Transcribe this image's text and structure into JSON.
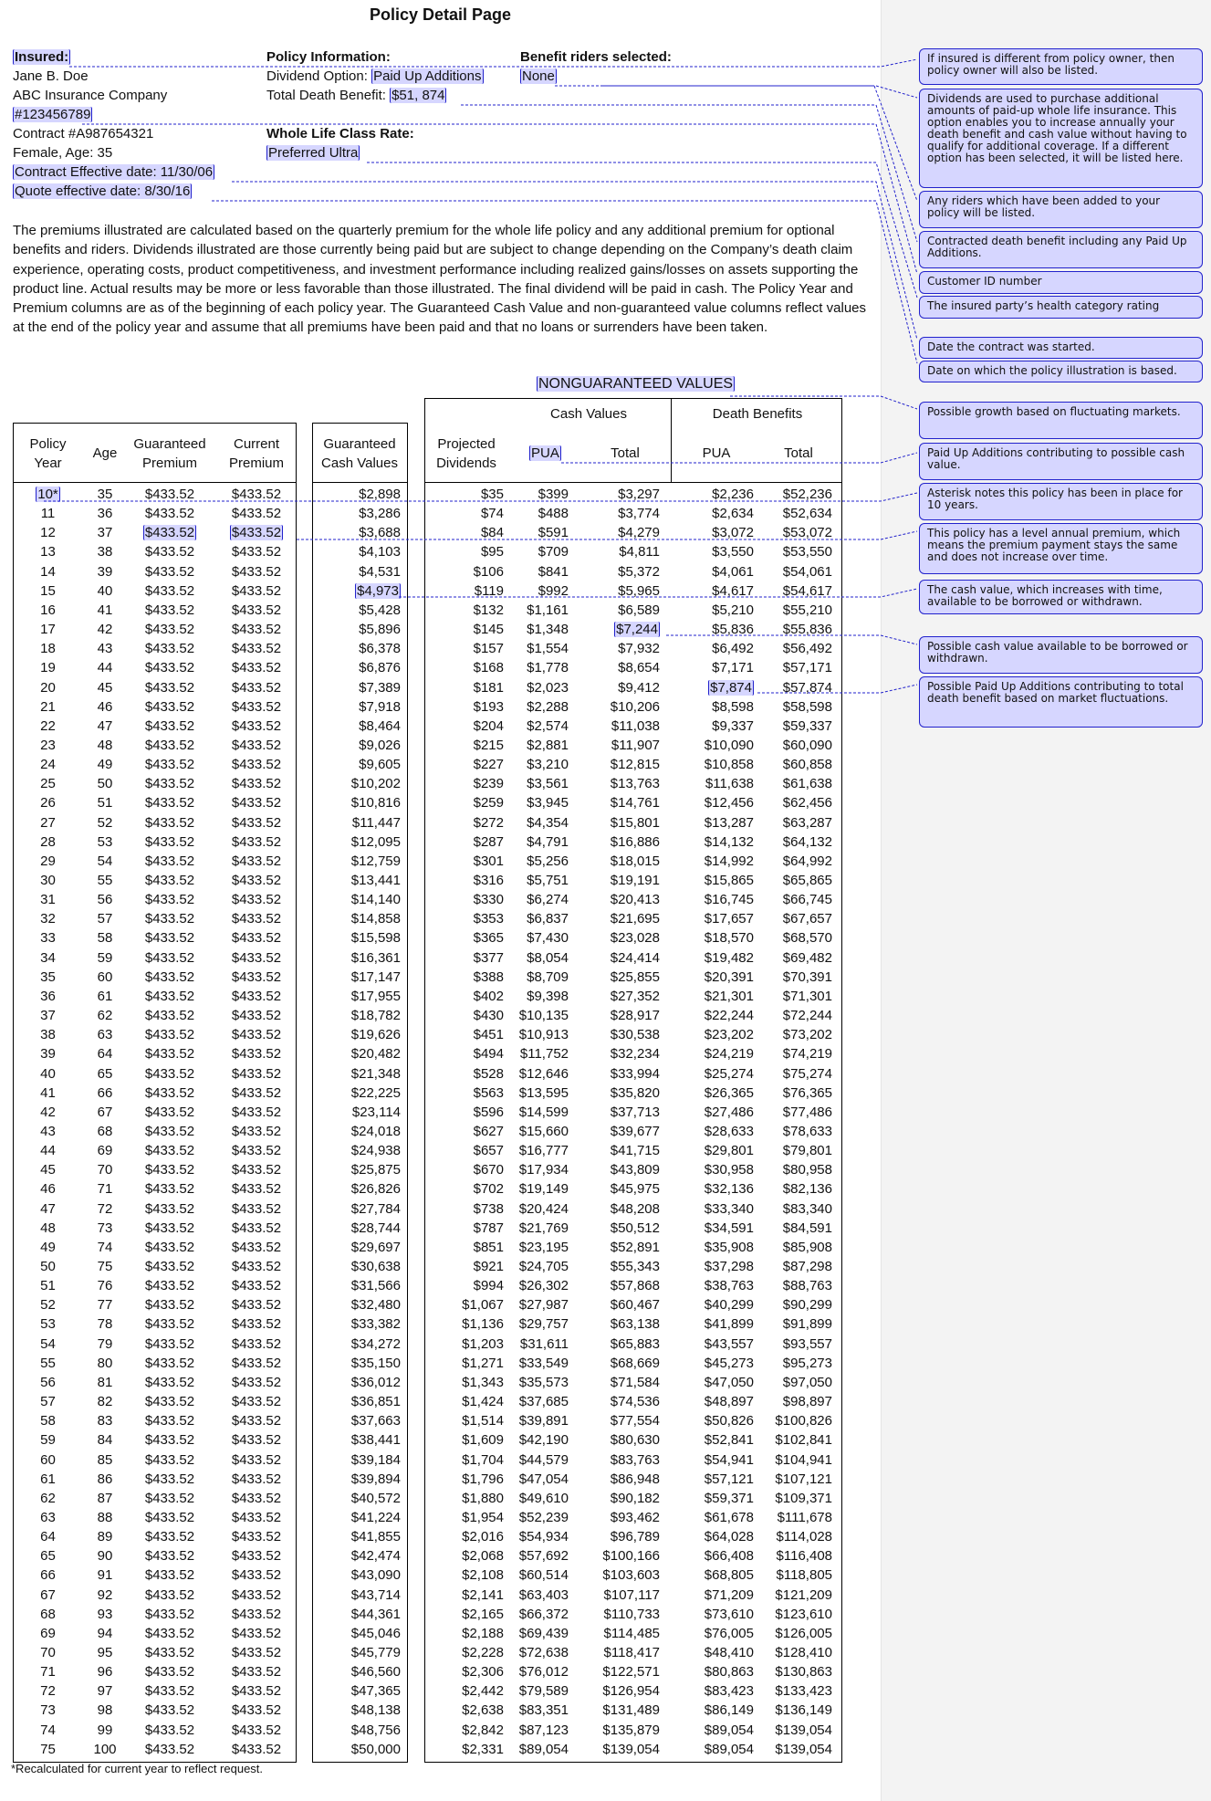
{
  "page_title": "Policy Detail Page",
  "insured": {
    "label": "Insured:",
    "name": "Jane B. Doe",
    "company": "ABC Insurance Company",
    "customer_id": "#123456789",
    "contract": "Contract #A987654321",
    "sex_age": "Female, Age: 35",
    "contract_effective": "Contract Effective date: 11/30/06",
    "quote_effective": "Quote effective date: 8/30/16"
  },
  "policy_info": {
    "label": "Policy Information:",
    "dividend_option_label": "Dividend Option: ",
    "dividend_option_value": "Paid Up Additions",
    "death_benefit_label": "Total Death Benefit: ",
    "death_benefit_value": "$51, 874",
    "class_rate_label": "Whole Life Class Rate:",
    "class_rate_value": "Preferred Ultra"
  },
  "riders": {
    "label": "Benefit riders selected:",
    "value": "None"
  },
  "disclaimer": "The premiums illustrated are calculated based on the quarterly premium for the whole life policy and any additional premium for optional benefits and riders. Dividends illustrated are those currently being paid but are subject to change depending on the Company’s death claim experience,  operating costs, product competitiveness, and investment performance including realized gains/losses on assets supporting the product line. Actual results may be more or less favorable than those illustrated. The final dividend will be paid in cash. The Policy Year and Premium columns are as of the beginning of each policy year. The Guaranteed Cash Value and non-guaranteed  value columns reflect values at the end of the policy year and assume that all premiums have been paid and that no loans or surrenders have been taken.",
  "table": {
    "nonguaranteed_title": "NONGUARANTEED VALUES",
    "group_cash_values": "Cash Values",
    "group_death_benefits": "Death  Benefits",
    "headers": {
      "policy_year": [
        "Policy",
        "Year"
      ],
      "age": "Age",
      "guaranteed_premium": [
        "Guaranteed",
        "Premium"
      ],
      "current_premium": [
        "Current",
        "Premium"
      ],
      "guaranteed_cash_values": [
        "Guaranteed",
        "Cash Values"
      ],
      "projected_dividends": [
        "Projected",
        "Dividends"
      ],
      "cv_pua": "PUA",
      "cv_total": "Total",
      "db_pua": "PUA",
      "db_total": "Total"
    },
    "rows": [
      [
        "10*",
        "35",
        "$433.52",
        "$433.52",
        "$2,898",
        "$35",
        "$399",
        "$3,297",
        "$2,236",
        "$52,236"
      ],
      [
        "11",
        "36",
        "$433.52",
        "$433.52",
        "$3,286",
        "$74",
        "$488",
        "$3,774",
        "$2,634",
        "$52,634"
      ],
      [
        "12",
        "37",
        "$433.52",
        "$433.52",
        "$3,688",
        "$84",
        "$591",
        "$4,279",
        "$3,072",
        "$53,072"
      ],
      [
        "13",
        "38",
        "$433.52",
        "$433.52",
        "$4,103",
        "$95",
        "$709",
        "$4,811",
        "$3,550",
        "$53,550"
      ],
      [
        "14",
        "39",
        "$433.52",
        "$433.52",
        "$4,531",
        "$106",
        "$841",
        "$5,372",
        "$4,061",
        "$54,061"
      ],
      [
        "15",
        "40",
        "$433.52",
        "$433.52",
        "$4,973",
        "$119",
        "$992",
        "$5,965",
        "$4,617",
        "$54,617"
      ],
      [
        "16",
        "41",
        "$433.52",
        "$433.52",
        "$5,428",
        "$132",
        "$1,161",
        "$6,589",
        "$5,210",
        "$55,210"
      ],
      [
        "17",
        "42",
        "$433.52",
        "$433.52",
        "$5,896",
        "$145",
        "$1,348",
        "$7,244",
        "$5,836",
        "$55,836"
      ],
      [
        "18",
        "43",
        "$433.52",
        "$433.52",
        "$6,378",
        "$157",
        "$1,554",
        "$7,932",
        "$6,492",
        "$56,492"
      ],
      [
        "19",
        "44",
        "$433.52",
        "$433.52",
        "$6,876",
        "$168",
        "$1,778",
        "$8,654",
        "$7,171",
        "$57,171"
      ],
      [
        "20",
        "45",
        "$433.52",
        "$433.52",
        "$7,389",
        "$181",
        "$2,023",
        "$9,412",
        "$7,874",
        "$57,874"
      ],
      [
        "21",
        "46",
        "$433.52",
        "$433.52",
        "$7,918",
        "$193",
        "$2,288",
        "$10,206",
        "$8,598",
        "$58,598"
      ],
      [
        "22",
        "47",
        "$433.52",
        "$433.52",
        "$8,464",
        "$204",
        "$2,574",
        "$11,038",
        "$9,337",
        "$59,337"
      ],
      [
        "23",
        "48",
        "$433.52",
        "$433.52",
        "$9,026",
        "$215",
        "$2,881",
        "$11,907",
        "$10,090",
        "$60,090"
      ],
      [
        "24",
        "49",
        "$433.52",
        "$433.52",
        "$9,605",
        "$227",
        "$3,210",
        "$12,815",
        "$10,858",
        "$60,858"
      ],
      [
        "25",
        "50",
        "$433.52",
        "$433.52",
        "$10,202",
        "$239",
        "$3,561",
        "$13,763",
        "$11,638",
        "$61,638"
      ],
      [
        "26",
        "51",
        "$433.52",
        "$433.52",
        "$10,816",
        "$259",
        "$3,945",
        "$14,761",
        "$12,456",
        "$62,456"
      ],
      [
        "27",
        "52",
        "$433.52",
        "$433.52",
        "$11,447",
        "$272",
        "$4,354",
        "$15,801",
        "$13,287",
        "$63,287"
      ],
      [
        "28",
        "53",
        "$433.52",
        "$433.52",
        "$12,095",
        "$287",
        "$4,791",
        "$16,886",
        "$14,132",
        "$64,132"
      ],
      [
        "29",
        "54",
        "$433.52",
        "$433.52",
        "$12,759",
        "$301",
        "$5,256",
        "$18,015",
        "$14,992",
        "$64,992"
      ],
      [
        "30",
        "55",
        "$433.52",
        "$433.52",
        "$13,441",
        "$316",
        "$5,751",
        "$19,191",
        "$15,865",
        "$65,865"
      ],
      [
        "31",
        "56",
        "$433.52",
        "$433.52",
        "$14,140",
        "$330",
        "$6,274",
        "$20,413",
        "$16,745",
        "$66,745"
      ],
      [
        "32",
        "57",
        "$433.52",
        "$433.52",
        "$14,858",
        "$353",
        "$6,837",
        "$21,695",
        "$17,657",
        "$67,657"
      ],
      [
        "33",
        "58",
        "$433.52",
        "$433.52",
        "$15,598",
        "$365",
        "$7,430",
        "$23,028",
        "$18,570",
        "$68,570"
      ],
      [
        "34",
        "59",
        "$433.52",
        "$433.52",
        "$16,361",
        "$377",
        "$8,054",
        "$24,414",
        "$19,482",
        "$69,482"
      ],
      [
        "35",
        "60",
        "$433.52",
        "$433.52",
        "$17,147",
        "$388",
        "$8,709",
        "$25,855",
        "$20,391",
        "$70,391"
      ],
      [
        "36",
        "61",
        "$433.52",
        "$433.52",
        "$17,955",
        "$402",
        "$9,398",
        "$27,352",
        "$21,301",
        "$71,301"
      ],
      [
        "37",
        "62",
        "$433.52",
        "$433.52",
        "$18,782",
        "$430",
        "$10,135",
        "$28,917",
        "$22,244",
        "$72,244"
      ],
      [
        "38",
        "63",
        "$433.52",
        "$433.52",
        "$19,626",
        "$451",
        "$10,913",
        "$30,538",
        "$23,202",
        "$73,202"
      ],
      [
        "39",
        "64",
        "$433.52",
        "$433.52",
        "$20,482",
        "$494",
        "$11,752",
        "$32,234",
        "$24,219",
        "$74,219"
      ],
      [
        "40",
        "65",
        "$433.52",
        "$433.52",
        "$21,348",
        "$528",
        "$12,646",
        "$33,994",
        "$25,274",
        "$75,274"
      ],
      [
        "41",
        "66",
        "$433.52",
        "$433.52",
        "$22,225",
        "$563",
        "$13,595",
        "$35,820",
        "$26,365",
        "$76,365"
      ],
      [
        "42",
        "67",
        "$433.52",
        "$433.52",
        "$23,114",
        "$596",
        "$14,599",
        "$37,713",
        "$27,486",
        "$77,486"
      ],
      [
        "43",
        "68",
        "$433.52",
        "$433.52",
        "$24,018",
        "$627",
        "$15,660",
        "$39,677",
        "$28,633",
        "$78,633"
      ],
      [
        "44",
        "69",
        "$433.52",
        "$433.52",
        "$24,938",
        "$657",
        "$16,777",
        "$41,715",
        "$29,801",
        "$79,801"
      ],
      [
        "45",
        "70",
        "$433.52",
        "$433.52",
        "$25,875",
        "$670",
        "$17,934",
        "$43,809",
        "$30,958",
        "$80,958"
      ],
      [
        "46",
        "71",
        "$433.52",
        "$433.52",
        "$26,826",
        "$702",
        "$19,149",
        "$45,975",
        "$32,136",
        "$82,136"
      ],
      [
        "47",
        "72",
        "$433.52",
        "$433.52",
        "$27,784",
        "$738",
        "$20,424",
        "$48,208",
        "$33,340",
        "$83,340"
      ],
      [
        "48",
        "73",
        "$433.52",
        "$433.52",
        "$28,744",
        "$787",
        "$21,769",
        "$50,512",
        "$34,591",
        "$84,591"
      ],
      [
        "49",
        "74",
        "$433.52",
        "$433.52",
        "$29,697",
        "$851",
        "$23,195",
        "$52,891",
        "$35,908",
        "$85,908"
      ],
      [
        "50",
        "75",
        "$433.52",
        "$433.52",
        "$30,638",
        "$921",
        "$24,705",
        "$55,343",
        "$37,298",
        "$87,298"
      ],
      [
        "51",
        "76",
        "$433.52",
        "$433.52",
        "$31,566",
        "$994",
        "$26,302",
        "$57,868",
        "$38,763",
        "$88,763"
      ],
      [
        "52",
        "77",
        "$433.52",
        "$433.52",
        "$32,480",
        "$1,067",
        "$27,987",
        "$60,467",
        "$40,299",
        "$90,299"
      ],
      [
        "53",
        "78",
        "$433.52",
        "$433.52",
        "$33,382",
        "$1,136",
        "$29,757",
        "$63,138",
        "$41,899",
        "$91,899"
      ],
      [
        "54",
        "79",
        "$433.52",
        "$433.52",
        "$34,272",
        "$1,203",
        "$31,611",
        "$65,883",
        "$43,557",
        "$93,557"
      ],
      [
        "55",
        "80",
        "$433.52",
        "$433.52",
        "$35,150",
        "$1,271",
        "$33,549",
        "$68,669",
        "$45,273",
        "$95,273"
      ],
      [
        "56",
        "81",
        "$433.52",
        "$433.52",
        "$36,012",
        "$1,343",
        "$35,573",
        "$71,584",
        "$47,050",
        "$97,050"
      ],
      [
        "57",
        "82",
        "$433.52",
        "$433.52",
        "$36,851",
        "$1,424",
        "$37,685",
        "$74,536",
        "$48,897",
        "$98,897"
      ],
      [
        "58",
        "83",
        "$433.52",
        "$433.52",
        "$37,663",
        "$1,514",
        "$39,891",
        "$77,554",
        "$50,826",
        "$100,826"
      ],
      [
        "59",
        "84",
        "$433.52",
        "$433.52",
        "$38,441",
        "$1,609",
        "$42,190",
        "$80,630",
        "$52,841",
        "$102,841"
      ],
      [
        "60",
        "85",
        "$433.52",
        "$433.52",
        "$39,184",
        "$1,704",
        "$44,579",
        "$83,763",
        "$54,941",
        "$104,941"
      ],
      [
        "61",
        "86",
        "$433.52",
        "$433.52",
        "$39,894",
        "$1,796",
        "$47,054",
        "$86,948",
        "$57,121",
        "$107,121"
      ],
      [
        "62",
        "87",
        "$433.52",
        "$433.52",
        "$40,572",
        "$1,880",
        "$49,610",
        "$90,182",
        "$59,371",
        "$109,371"
      ],
      [
        "63",
        "88",
        "$433.52",
        "$433.52",
        "$41,224",
        "$1,954",
        "$52,239",
        "$93,462",
        "$61,678",
        "$111,678"
      ],
      [
        "64",
        "89",
        "$433.52",
        "$433.52",
        "$41,855",
        "$2,016",
        "$54,934",
        "$96,789",
        "$64,028",
        "$114,028"
      ],
      [
        "65",
        "90",
        "$433.52",
        "$433.52",
        "$42,474",
        "$2,068",
        "$57,692",
        "$100,166",
        "$66,408",
        "$116,408"
      ],
      [
        "66",
        "91",
        "$433.52",
        "$433.52",
        "$43,090",
        "$2,108",
        "$60,514",
        "$103,603",
        "$68,805",
        "$118,805"
      ],
      [
        "67",
        "92",
        "$433.52",
        "$433.52",
        "$43,714",
        "$2,141",
        "$63,403",
        "$107,117",
        "$71,209",
        "$121,209"
      ],
      [
        "68",
        "93",
        "$433.52",
        "$433.52",
        "$44,361",
        "$2,165",
        "$66,372",
        "$110,733",
        "$73,610",
        "$123,610"
      ],
      [
        "69",
        "94",
        "$433.52",
        "$433.52",
        "$45,046",
        "$2,188",
        "$69,439",
        "$114,485",
        "$76,005",
        "$126,005"
      ],
      [
        "70",
        "95",
        "$433.52",
        "$433.52",
        "$45,779",
        "$2,228",
        "$72,638",
        "$118,417",
        "$48,410",
        "$128,410"
      ],
      [
        "71",
        "96",
        "$433.52",
        "$433.52",
        "$46,560",
        "$2,306",
        "$76,012",
        "$122,571",
        "$80,863",
        "$130,863"
      ],
      [
        "72",
        "97",
        "$433.52",
        "$433.52",
        "$47,365",
        "$2,442",
        "$79,589",
        "$126,954",
        "$83,423",
        "$133,423"
      ],
      [
        "73",
        "98",
        "$433.52",
        "$433.52",
        "$48,138",
        "$2,638",
        "$83,351",
        "$131,489",
        "$86,149",
        "$136,149"
      ],
      [
        "74",
        "99",
        "$433.52",
        "$433.52",
        "$48,756",
        "$2,842",
        "$87,123",
        "$135,879",
        "$89,054",
        "$139,054"
      ],
      [
        "75",
        "100",
        "$433.52",
        "$433.52",
        "$50,000",
        "$2,331",
        "$89,054",
        "$139,054",
        "$89,054",
        "$139,054"
      ]
    ]
  },
  "footnote": "*Recalculated for current year to reflect request.",
  "callouts": [
    "If insured is different from policy owner, then policy owner will also be listed.",
    "Dividends are used to purchase additional amounts of paid-up whole life insurance. This option enables you to increase annually your death benefit and cash value without having to qualify for additional coverage. If a different option has been selected, it will be listed here.",
    "Any riders which have been added to your policy will be listed.",
    "Contracted death benefit including any Paid Up Additions.",
    "Customer ID number",
    "The insured party’s health category rating",
    "Date the contract was started.",
    "Date on which the policy illustration is based.",
    "Possible growth based on fluctuating markets.",
    "Paid Up Additions contributing to possible cash value.",
    "Asterisk notes this policy has been in place for 10 years.",
    "This policy has a level annual premium, which means the premium payment stays the same and does not increase over time.",
    "The cash value, which increases with time, available to be borrowed or withdrawn.",
    "Possible cash value available to be borrowed or withdrawn.",
    "Possible Paid Up Additions contributing to total death benefit based on market fluctuations."
  ],
  "colors": {
    "highlight": "#d6d6ff",
    "connector": "#2222cc",
    "panel": "#f3f3f3"
  }
}
